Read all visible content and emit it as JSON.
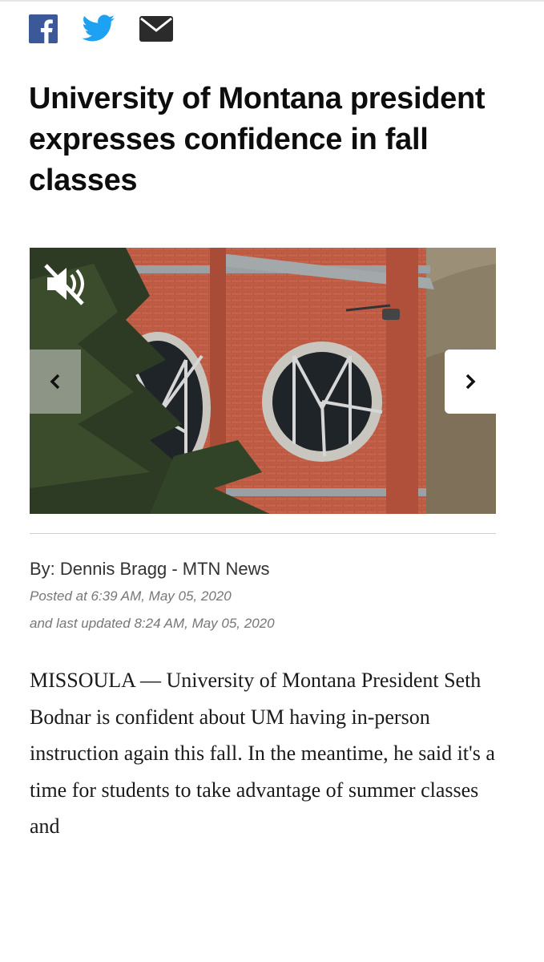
{
  "share": {
    "icons": [
      "facebook-icon",
      "twitter-icon",
      "email-icon"
    ],
    "colors": {
      "facebook": "#3b5998",
      "twitter": "#1da1f2",
      "email": "#2b2b2b"
    }
  },
  "article": {
    "headline": "University of Montana president expresses confidence in fall classes",
    "byline_prefix": "By: ",
    "author": "Dennis Bragg - MTN News",
    "posted": "Posted at 6:39 AM, May 05, 2020",
    "updated": "and last updated 8:24 AM, May 05, 2020",
    "body": "MISSOULA — University of Montana President Seth Bodnar is confident about UM having in-person instruction again this fall. In the meantime, he said it's a time for students to take advantage of summer classes and"
  },
  "media": {
    "mute_icon": "speaker-muted-icon",
    "prev_icon": "chevron-left-icon",
    "next_icon": "chevron-right-icon",
    "prev_label": "‹",
    "next_label": "›"
  }
}
